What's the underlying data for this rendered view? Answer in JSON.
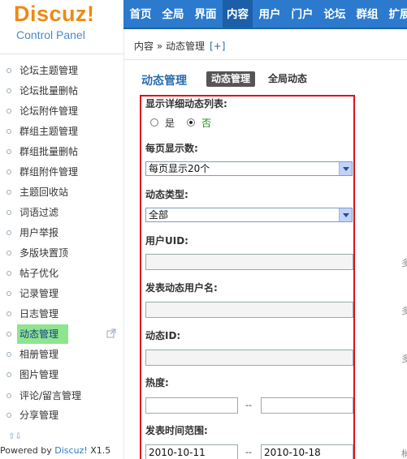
{
  "logo": {
    "title": "Discuz!",
    "subtitle": "Control Panel"
  },
  "topnav": [
    "首页",
    "全局",
    "界面",
    "内容",
    "用户",
    "门户",
    "论坛",
    "群组",
    "扩展"
  ],
  "breadcrumb": {
    "path": "内容 » 动态管理",
    "add": "[+]"
  },
  "sidebar": {
    "items": [
      "论坛主题管理",
      "论坛批量删帖",
      "论坛附件管理",
      "群组主题管理",
      "群组批量删帖",
      "群组附件管理",
      "主题回收站",
      "词语过滤",
      "用户举报",
      "多版块置顶",
      "帖子优化",
      "记录管理",
      "日志管理",
      "动态管理",
      "相册管理",
      "图片管理",
      "评论/留言管理",
      "分享管理"
    ],
    "active_index": 13,
    "scroll_arrows": "⇧⇩",
    "powered_prefix": "Powered by ",
    "powered_brand": "Discuz!",
    "powered_version": " X1.5"
  },
  "main": {
    "title": "动态管理",
    "tabs": [
      "动态管理",
      "全局动态"
    ],
    "form": {
      "detail_label": "显示详细动态列表:",
      "radio_yes": "是",
      "radio_no": "否",
      "radio_selected": "否",
      "per_page_label": "每页显示数:",
      "per_page_value": "每页显示20个",
      "type_label": "动态类型:",
      "type_value": "全部",
      "uid_label": "用户UID:",
      "uid_value": "",
      "username_label": "发表动态用户名:",
      "username_value": "",
      "feed_id_label": "动态ID:",
      "feed_id_value": "",
      "hot_label": "热度:",
      "hot_from": "",
      "hot_to": "",
      "range_sep": "--",
      "time_label": "发表时间范围:",
      "time_from": "2010-10-11",
      "time_to": "2010-10-18"
    },
    "edge_notes": [
      "多",
      "多",
      "多",
      "梢"
    ]
  },
  "colors": {
    "nav_bg": "#2b7acd",
    "nav_active": "#1b5fa8",
    "accent": "#ec8a16",
    "highlight": "#8ee58e",
    "frame": "#e0101a"
  }
}
